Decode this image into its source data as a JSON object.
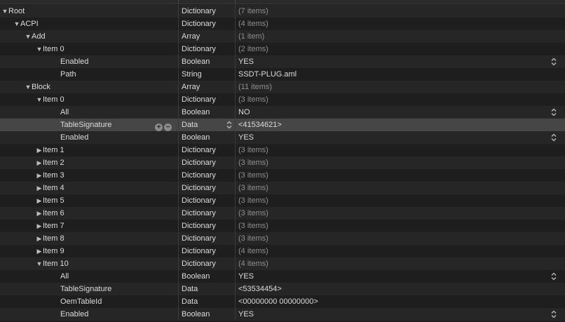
{
  "plist": {
    "rows": [
      {
        "key": "Root",
        "depth": 0,
        "disclosure": "open",
        "type": "Dictionary",
        "value": "(7 items)",
        "muted": true
      },
      {
        "key": "ACPI",
        "depth": 1,
        "disclosure": "open",
        "type": "Dictionary",
        "value": "(4 items)",
        "muted": true
      },
      {
        "key": "Add",
        "depth": 2,
        "disclosure": "open",
        "type": "Array",
        "value": "(1 item)",
        "muted": true
      },
      {
        "key": "Item 0",
        "depth": 3,
        "disclosure": "open",
        "type": "Dictionary",
        "value": "(2 items)",
        "muted": true
      },
      {
        "key": "Enabled",
        "depth": 4,
        "disclosure": "none",
        "type": "Boolean",
        "value": "YES",
        "muted": false,
        "stepper": true
      },
      {
        "key": "Path",
        "depth": 4,
        "disclosure": "none",
        "type": "String",
        "value": "SSDT-PLUG.aml",
        "muted": false
      },
      {
        "key": "Block",
        "depth": 2,
        "disclosure": "open",
        "type": "Array",
        "value": "(11 items)",
        "muted": true
      },
      {
        "key": "Item 0",
        "depth": 3,
        "disclosure": "open",
        "type": "Dictionary",
        "value": "(3 items)",
        "muted": true
      },
      {
        "key": "All",
        "depth": 4,
        "disclosure": "none",
        "type": "Boolean",
        "value": "NO",
        "muted": false,
        "stepper": true
      },
      {
        "key": "TableSignature",
        "depth": 4,
        "disclosure": "none",
        "type": "Data",
        "value": "<41534621>",
        "muted": false,
        "selected": true
      },
      {
        "key": "Enabled",
        "depth": 4,
        "disclosure": "none",
        "type": "Boolean",
        "value": "YES",
        "muted": false,
        "stepper": true
      },
      {
        "key": "Item 1",
        "depth": 3,
        "disclosure": "closed",
        "type": "Dictionary",
        "value": "(3 items)",
        "muted": true
      },
      {
        "key": "Item 2",
        "depth": 3,
        "disclosure": "closed",
        "type": "Dictionary",
        "value": "(3 items)",
        "muted": true
      },
      {
        "key": "Item 3",
        "depth": 3,
        "disclosure": "closed",
        "type": "Dictionary",
        "value": "(3 items)",
        "muted": true
      },
      {
        "key": "Item 4",
        "depth": 3,
        "disclosure": "closed",
        "type": "Dictionary",
        "value": "(3 items)",
        "muted": true
      },
      {
        "key": "Item 5",
        "depth": 3,
        "disclosure": "closed",
        "type": "Dictionary",
        "value": "(3 items)",
        "muted": true
      },
      {
        "key": "Item 6",
        "depth": 3,
        "disclosure": "closed",
        "type": "Dictionary",
        "value": "(3 items)",
        "muted": true
      },
      {
        "key": "Item 7",
        "depth": 3,
        "disclosure": "closed",
        "type": "Dictionary",
        "value": "(3 items)",
        "muted": true
      },
      {
        "key": "Item 8",
        "depth": 3,
        "disclosure": "closed",
        "type": "Dictionary",
        "value": "(3 items)",
        "muted": true
      },
      {
        "key": "Item 9",
        "depth": 3,
        "disclosure": "closed",
        "type": "Dictionary",
        "value": "(4 items)",
        "muted": true
      },
      {
        "key": "Item 10",
        "depth": 3,
        "disclosure": "open",
        "type": "Dictionary",
        "value": "(4 items)",
        "muted": true
      },
      {
        "key": "All",
        "depth": 4,
        "disclosure": "none",
        "type": "Boolean",
        "value": "YES",
        "muted": false,
        "stepper": true
      },
      {
        "key": "TableSignature",
        "depth": 4,
        "disclosure": "none",
        "type": "Data",
        "value": "<53534454>",
        "muted": false
      },
      {
        "key": "OemTableId",
        "depth": 4,
        "disclosure": "none",
        "type": "Data",
        "value": "<00000000 00000000>",
        "muted": false
      },
      {
        "key": "Enabled",
        "depth": 4,
        "disclosure": "none",
        "type": "Boolean",
        "value": "YES",
        "muted": false,
        "stepper": true
      }
    ]
  },
  "icons": {
    "disclosure_open": "disclosure-open-icon",
    "disclosure_closed": "disclosure-closed-icon",
    "stepper": "up-down-stepper-icon",
    "add": "add-row-icon",
    "remove": "remove-row-icon"
  },
  "colors": {
    "background": "#1e1e1e",
    "alt_row": "#262626",
    "selected_row": "#464646",
    "text": "#dcdcdc",
    "muted_text": "#8f8f8f"
  }
}
